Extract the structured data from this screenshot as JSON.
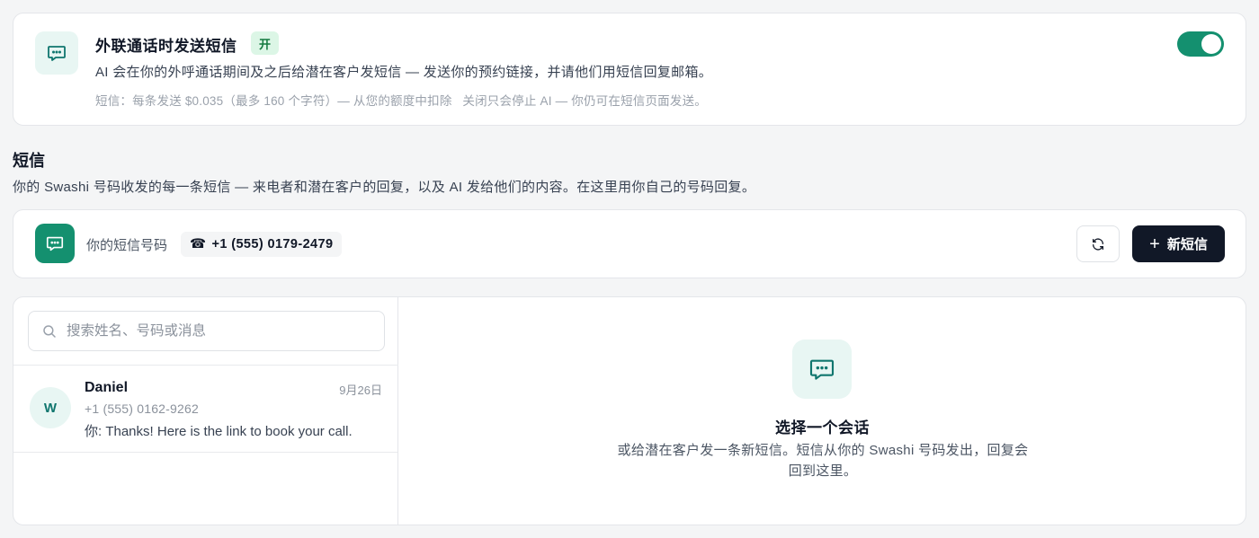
{
  "settings": {
    "title": "外联通话时发送短信",
    "badge": "开",
    "description": "AI 会在你的外呼通话期间及之后给潜在客户发短信 — 发送你的预约链接，并请他们用短信回复邮箱。",
    "note": "短信：每条发送 $0.035（最多 160 个字符）— 从您的额度中扣除   关闭只会停止 AI — 你仍可在短信页面发送。",
    "toggle_on": true,
    "icon": "chat-bubble-icon"
  },
  "section": {
    "title": "短信",
    "description": "你的 Swashi 号码收发的每一条短信 — 来电者和潜在客户的回复，以及 AI 发给他们的内容。在这里用你自己的号码回复。"
  },
  "number_bar": {
    "label": "你的短信号码",
    "phone_icon": "☎",
    "phone_number": "+1 (555) 0179-2479",
    "refresh_icon": "refresh-icon",
    "new_button_icon": "+",
    "new_button_label": "新短信"
  },
  "search": {
    "placeholder": "搜索姓名、号码或消息",
    "value": ""
  },
  "conversations": [
    {
      "avatar": "W",
      "name": "Daniel",
      "date": "9月26日",
      "phone": "+1 (555) 0162-9262",
      "preview": "你: Thanks! Here is the link to book your call."
    }
  ],
  "empty_state": {
    "title": "选择一个会话",
    "description": "或给潜在客户发一条新短信。短信从你的 Swashi 号码发出，回复会回到这里。"
  },
  "colors": {
    "accent": "#14906f",
    "accent_soft": "#e8f6f3",
    "badge_bg": "#dcf6e6",
    "badge_text": "#137a3f",
    "primary_button": "#111827"
  }
}
